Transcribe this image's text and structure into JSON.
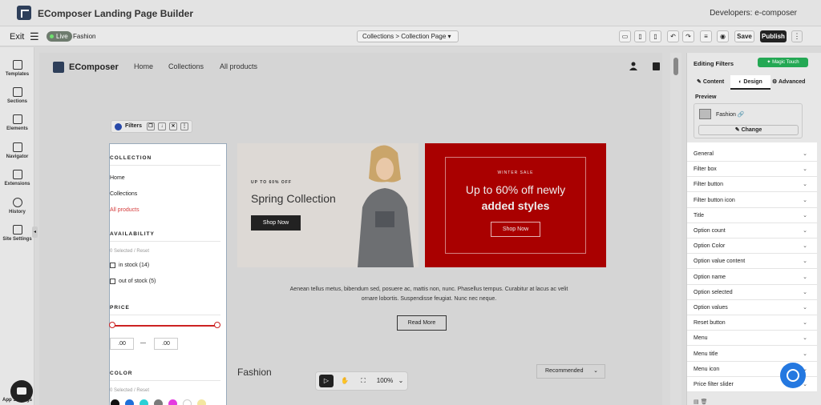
{
  "app": {
    "title": "EComposer Landing Page Builder",
    "developer": "Developers: e-composer"
  },
  "toolbar": {
    "exit_label": "Exit",
    "live_label": "Live",
    "page_name": "Fashion",
    "breadcrumb": "Collections  >  Collection Page",
    "save_label": "Save",
    "publish_label": "Publish"
  },
  "sidebar": {
    "items": [
      {
        "label": "Templates",
        "icon": "templates-icon"
      },
      {
        "label": "Sections",
        "icon": "sections-icon"
      },
      {
        "label": "Elements",
        "icon": "elements-icon"
      },
      {
        "label": "Navigator",
        "icon": "navigator-icon"
      },
      {
        "label": "Extensions",
        "icon": "extensions-icon"
      },
      {
        "label": "History",
        "icon": "history-icon"
      },
      {
        "label": "Site Settings",
        "icon": "site-settings-icon"
      }
    ],
    "app_settings": "App Settings"
  },
  "store": {
    "brand": "EComposer",
    "nav": [
      "Home",
      "Collections",
      "All products"
    ]
  },
  "filter_toolbar": {
    "label": "Filters"
  },
  "filters": {
    "collection_title": "COLLECTION",
    "collection_links": [
      "Home",
      "Collections",
      "All products"
    ],
    "availability_title": "AVAILABILITY",
    "availability_meta": "0 Selected  /   Reset",
    "availability_options": [
      "in stock (14)",
      "out of stock (5)"
    ],
    "price_title": "PRICE",
    "price_min": ".00",
    "price_sep": "—",
    "price_max": ".00",
    "color_title": "COLOR",
    "color_meta": "0 Selected  /   Reset",
    "swatches": [
      "#111111",
      "#1e6fd9",
      "#2ad0d6",
      "#7a7a7a",
      "#e43be0",
      "#ffffff",
      "#f3e6a0"
    ]
  },
  "banner1": {
    "kicker": "UP TO 60% OFF",
    "heading": "Spring Collection",
    "button": "Shop Now"
  },
  "banner2": {
    "kicker": "WINTER SALE",
    "line1": "Up to 60% off newly",
    "line2": "added styles",
    "button": "Shop Now"
  },
  "content": {
    "paragraph": "Aenean tellus metus, bibendum sed, posuere ac, mattis non, nunc. Phasellus tempus. Curabitur at lacus ac velit ornare lobortis. Suspendisse feugiat. Nunc nec neque.",
    "read_more": "Read More",
    "section_title": "Fashion",
    "sort_label": "Recommended"
  },
  "zoom": {
    "level": "100%"
  },
  "panel": {
    "title": "Editing Filters",
    "magic": "Magic Touch",
    "tabs": [
      "Content",
      "Design",
      "Advanced"
    ],
    "preview_label": "Preview",
    "preview_name": "Fashion",
    "change_label": "Change",
    "rows": [
      "General",
      "Filter box",
      "Filter button",
      "Filter button icon",
      "Title",
      "Option count",
      "Option Color",
      "Option value content",
      "Option name",
      "Option selected",
      "Option values",
      "Reset button",
      "Menu",
      "Menu title",
      "Menu icon",
      "Price filter slider"
    ]
  },
  "colors": {
    "accent": "#24a854",
    "banner_red": "#a90000",
    "link_red": "#d43b3b",
    "slider_red": "#cc2222"
  }
}
